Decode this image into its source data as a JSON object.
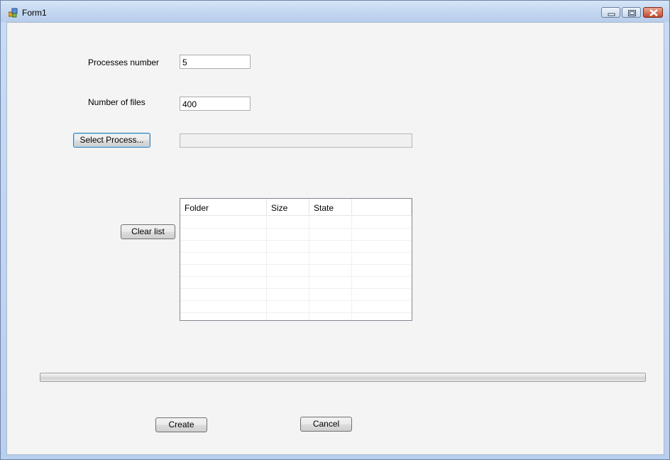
{
  "window": {
    "title": "Form1"
  },
  "form": {
    "processes_label": "Processes number",
    "processes_value": "5",
    "files_label": "Number of files",
    "files_value": "400",
    "select_process_label": "Select Process...",
    "selected_process_path": "",
    "clear_list_label": "Clear list",
    "create_label": "Create",
    "cancel_label": "Cancel"
  },
  "listview": {
    "columns": [
      "Folder",
      "Size",
      "State",
      ""
    ],
    "rows": []
  },
  "progress": {
    "value": 0
  }
}
